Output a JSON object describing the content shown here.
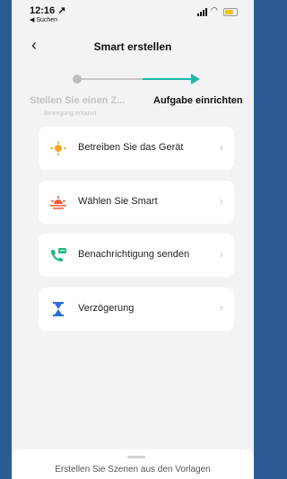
{
  "status_bar": {
    "time": "12:16 ↗",
    "back_app": "◀ Suchen"
  },
  "header": {
    "back_icon": "‹",
    "title": "Smart erstellen"
  },
  "steps": [
    {
      "label": "Stellen Sie einen Z...",
      "sublabel": "Bewegung erkannt"
    },
    {
      "label": "Aufgabe einrichten"
    }
  ],
  "tasks": [
    {
      "label": "Betreiben Sie das Gerät",
      "icon": "device-icon",
      "color": "#f5a623"
    },
    {
      "label": "Wählen Sie Smart",
      "icon": "sunrise-icon",
      "color": "#f15a3a"
    },
    {
      "label": "Benachrichtigung senden",
      "icon": "phone-message-icon",
      "color": "#1db97a"
    },
    {
      "label": "Verzögerung",
      "icon": "hourglass-icon",
      "color": "#2e6fd6"
    }
  ],
  "chevron": "›",
  "footer": {
    "text": "Erstellen Sie Szenen aus den Vorlagen"
  }
}
